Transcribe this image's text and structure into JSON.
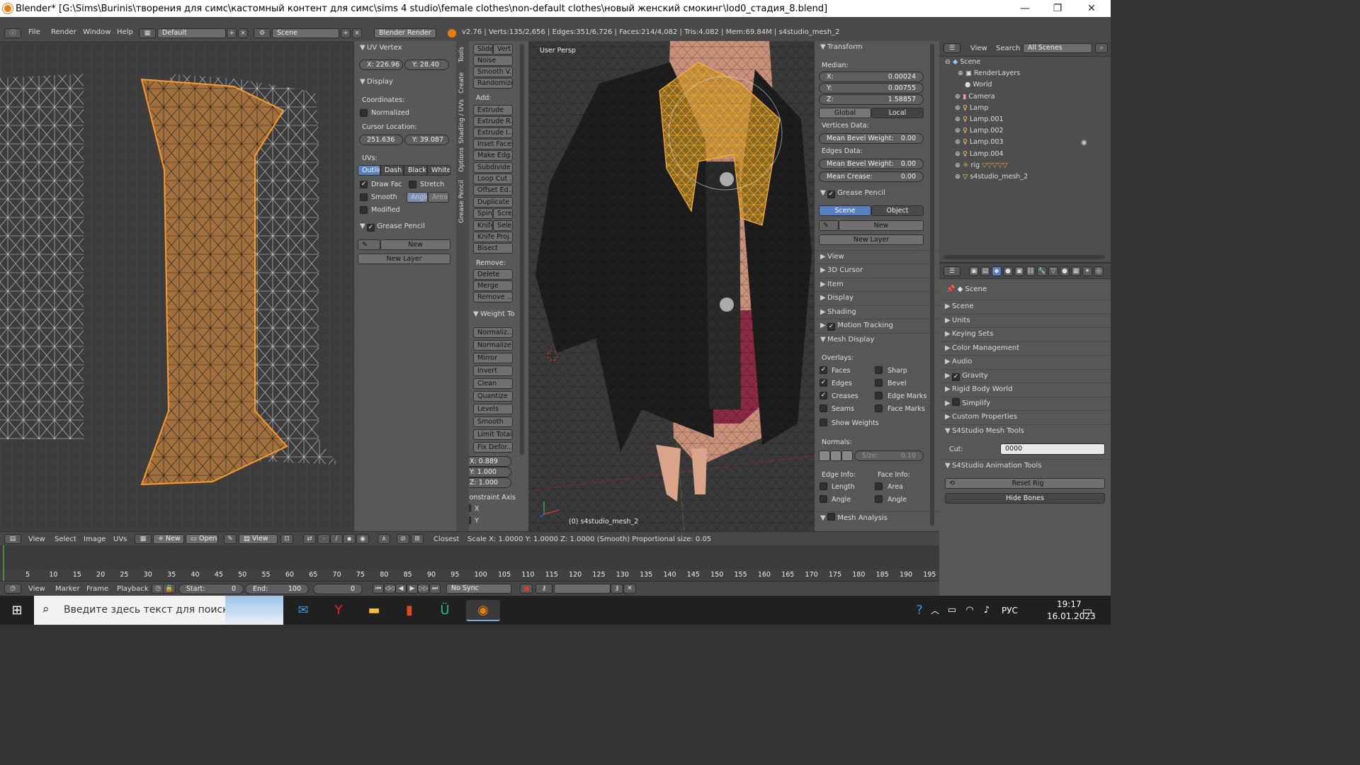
{
  "window": {
    "title": "Blender* [G:\\Sims\\Burinis\\творения для симс\\кастомный контент для симс\\sims 4 studio\\female clothes\\non-default clothes\\новый женский смокинг\\lod0_стадия_8.blend]",
    "minimize": "—",
    "maximize": "❐",
    "close": "✕"
  },
  "infobar": {
    "menus": [
      "File",
      "Render",
      "Window",
      "Help"
    ],
    "layout": "Default",
    "scene": "Scene",
    "engine": "Blender Render",
    "stats": "v2.76 | Verts:135/2,656 | Edges:351/6,726 | Faces:214/4,082 | Tris:4,082 | Mem:69.84M | s4studio_mesh_2"
  },
  "uv_panel": {
    "title": "UV Vertex",
    "x_label": "X:",
    "x_val": "226.96",
    "y_label": "Y:",
    "y_val": "28.40",
    "display": "Display",
    "coords": "Coordinates:",
    "normalized": "Normalized",
    "cursor": "Cursor Location:",
    "cx": "251.636",
    "cy": "Y: 39.087",
    "uvs": "UVs:",
    "uv_modes": [
      "Outline",
      "Dash",
      "Black",
      "White"
    ],
    "draw_fac": "Draw Fac",
    "stretch": "Stretch",
    "smooth": "Smooth",
    "angle": "Angle",
    "area": "Area",
    "modified": "Modified",
    "grease": "Grease Pencil",
    "new": "New",
    "new_layer": "New Layer"
  },
  "uv_header": {
    "menus": [
      "View",
      "Select",
      "Image",
      "UVs"
    ],
    "new": "New",
    "open": "Open",
    "view": "View",
    "closest": "Closest"
  },
  "tools": {
    "tabs": [
      "Tools",
      "Create",
      "Shading / UVs",
      "Options",
      "Grease Pencil"
    ],
    "top": [
      "Slide",
      "Vert"
    ],
    "items1": [
      "Noise",
      "Smooth V...",
      "Randomize"
    ],
    "add": "Add:",
    "items2": [
      "Extrude",
      "Extrude R...",
      "Extrude I...",
      "Inset Faces",
      "Make Edg...",
      "Subdivide",
      "Loop Cut ...",
      "Offset Ed...",
      "Duplicate"
    ],
    "spin": [
      "Spin",
      "Scre"
    ],
    "knife": [
      "Knife",
      "Sele"
    ],
    "items3": [
      "Knife Proj...",
      "Bisect"
    ],
    "remove": "Remove:",
    "items4": [
      "Delete",
      "Merge",
      "Remove ..."
    ],
    "weight": "Weight To",
    "items5": [
      "Normaliz...",
      "Normalize",
      "Mirror",
      "Invert",
      "Clean",
      "Quantize",
      "Levels",
      "Smooth",
      "Limit Total",
      "Fix Defor..."
    ],
    "vx": "X:",
    "vxv": "0.889",
    "vy": "Y:",
    "vyv": "1.000",
    "vz": "Z:",
    "vzv": "1.000",
    "constraint": "Constraint Axis",
    "cx": "X",
    "cy": "Y"
  },
  "viewport": {
    "label": "User Persp",
    "object": "(0) s4studio_mesh_2",
    "status": "Scale X: 1.0000   Y: 1.0000  Z: 1.0000 (Smooth) Proportional size: 0.05"
  },
  "props": {
    "transform": "Transform",
    "median": "Median:",
    "x": "X:",
    "xv": "0.00024",
    "y": "Y:",
    "yv": "0.00755",
    "z": "Z:",
    "zv": "1.58857",
    "global": "Global",
    "local": "Local",
    "vdata": "Vertices Data:",
    "mbw": "Mean Bevel Weight:",
    "mbwv": "0.00",
    "edata": "Edges Data:",
    "mbw2v": "0.00",
    "crease": "Mean Crease:",
    "creasev": "0.00",
    "grease": "Grease Pencil",
    "scene": "Scene",
    "object": "Object",
    "new": "New",
    "new_layer": "New Layer",
    "sections": [
      "View",
      "3D Cursor",
      "Item",
      "Display",
      "Shading",
      "Motion Tracking",
      "Mesh Display"
    ],
    "overlays": "Overlays:",
    "ov_left": [
      "Faces",
      "Edges",
      "Creases",
      "Seams"
    ],
    "ov_right": [
      "Sharp",
      "Bevel",
      "Edge Marks",
      "Face Marks"
    ],
    "show_weights": "Show Weights",
    "normals": "Normals:",
    "size": "Size:",
    "size_v": "0.10",
    "edge_info": "Edge Info:",
    "face_info": "Face Info:",
    "length": "Length",
    "angle": "Angle",
    "area": "Area",
    "angle2": "Angle",
    "mesh_analysis": "Mesh Analysis"
  },
  "outliner": {
    "menus": [
      "View",
      "Search"
    ],
    "filter": "All Scenes",
    "items": [
      "Scene",
      "RenderLayers",
      "World",
      "Camera",
      "Lamp",
      "Lamp.001",
      "Lamp.002",
      "Lamp.003",
      "Lamp.004",
      "rig",
      "s4studio_mesh_2"
    ]
  },
  "scene_props": {
    "title": "Scene",
    "sections": [
      "Scene",
      "Units",
      "Keying Sets",
      "Color Management",
      "Audio",
      "Gravity",
      "Rigid Body World",
      "Simplify",
      "Custom Properties"
    ],
    "mesh_tools": "S4Studio Mesh Tools",
    "cut": "Cut:",
    "cut_v": "0000",
    "anim_tools": "S4Studio Animation Tools",
    "reset_rig": "Reset Rig",
    "hide_bones": "Hide Bones"
  },
  "timeline": {
    "ticks": [
      "5",
      "10",
      "15",
      "20",
      "25",
      "30",
      "35",
      "40",
      "45",
      "50",
      "55",
      "60",
      "65",
      "70",
      "75",
      "80",
      "85",
      "90",
      "95",
      "100",
      "105",
      "110",
      "115",
      "120",
      "125",
      "130",
      "135",
      "140",
      "145",
      "150",
      "155",
      "160",
      "165",
      "170",
      "175",
      "180",
      "185",
      "190",
      "195"
    ],
    "menus": [
      "View",
      "Marker",
      "Frame",
      "Playback"
    ],
    "start": "Start:",
    "start_v": "0",
    "end": "End:",
    "end_v": "100",
    "cur": "0",
    "sync": "No Sync"
  },
  "taskbar": {
    "search": "Введите здесь текст для поиска",
    "lang": "РУС",
    "time": "19:17",
    "date": "16.01.2023"
  }
}
